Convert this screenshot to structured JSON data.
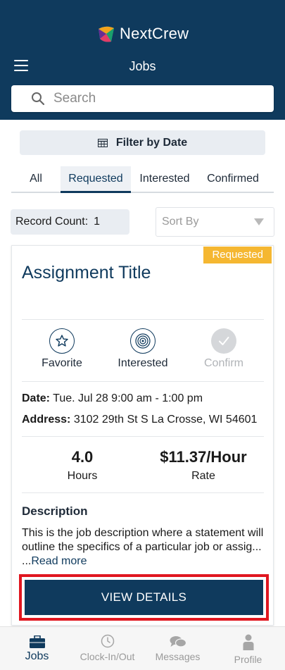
{
  "app": {
    "name": "NextCrew",
    "page_title": "Jobs"
  },
  "search": {
    "placeholder": "Search",
    "value": ""
  },
  "filter": {
    "label": "Filter by Date"
  },
  "tabs": [
    {
      "label": "All",
      "active": false
    },
    {
      "label": "Requested",
      "active": true
    },
    {
      "label": "Interested",
      "active": false
    },
    {
      "label": "Confirmed",
      "active": false
    }
  ],
  "record_count": {
    "label": "Record Count:",
    "value": "1"
  },
  "sort": {
    "placeholder": "Sort By"
  },
  "job_card": {
    "status": "Requested",
    "title": "Assignment Title",
    "actions": [
      {
        "label": "Favorite",
        "icon": "star-icon",
        "enabled": true
      },
      {
        "label": "Interested",
        "icon": "target-icon",
        "enabled": true
      },
      {
        "label": "Confirm",
        "icon": "check-icon",
        "enabled": false
      }
    ],
    "date_label": "Date:",
    "date_value": "Tue. Jul 28 9:00 am - 1:00 pm",
    "address_label": "Address:",
    "address_value": "3102 29th St S La Crosse, WI 54601",
    "hours_value": "4.0",
    "hours_label": "Hours",
    "rate_value": "$11.37/Hour",
    "rate_label": "Rate",
    "description_title": "Description",
    "description_text": "This is the job description where a statement will outline the specifics of a particular job or assig... ...",
    "read_more": "Read more",
    "view_details": "VIEW DETAILS"
  },
  "bottom_nav": [
    {
      "label": "Jobs",
      "icon": "briefcase-icon",
      "active": true
    },
    {
      "label": "Clock-In/Out",
      "icon": "clock-icon",
      "active": false
    },
    {
      "label": "Messages",
      "icon": "chat-icon",
      "active": false
    },
    {
      "label": "Profile",
      "icon": "person-icon",
      "active": false
    }
  ],
  "colors": {
    "primary": "#0f3a5d",
    "badge": "#f5b731",
    "highlight_border": "#e0161f",
    "inactive": "#9a9a9a"
  }
}
